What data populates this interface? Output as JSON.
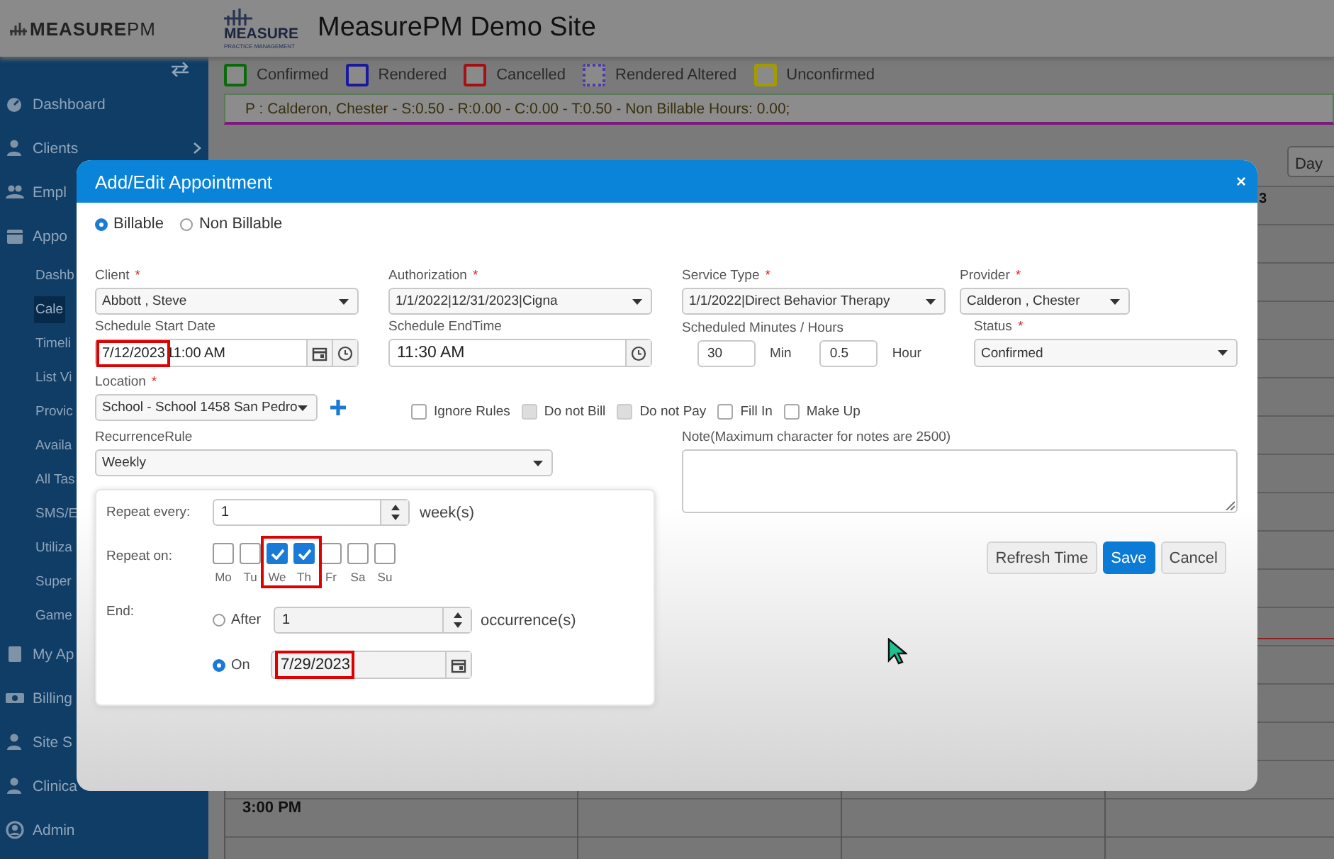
{
  "header": {
    "logo": "**MEASURE**PM",
    "brand_logo": "MEASURE",
    "brand_tagline": "PRACTICE MANAGEMENT",
    "title": "MeasurePM Demo Site"
  },
  "sidebar": {
    "items": [
      {
        "label": "Dashboard",
        "kind": "main",
        "selected": false,
        "expandable": false
      },
      {
        "label": "Clients",
        "kind": "main",
        "selected": false,
        "expandable": true
      },
      {
        "label": "Empl",
        "kind": "main",
        "selected": false,
        "expandable": false
      },
      {
        "label": "Appo",
        "kind": "main",
        "selected": false,
        "expandable": false
      },
      {
        "label": "Dashb",
        "kind": "sub",
        "selected": false,
        "expandable": false
      },
      {
        "label": "Cale",
        "kind": "sub",
        "selected": true,
        "expandable": false
      },
      {
        "label": "Timeli",
        "kind": "sub",
        "selected": false,
        "expandable": false
      },
      {
        "label": "List Vi",
        "kind": "sub",
        "selected": false,
        "expandable": false
      },
      {
        "label": "Provic",
        "kind": "sub",
        "selected": false,
        "expandable": false
      },
      {
        "label": "Availa",
        "kind": "sub",
        "selected": false,
        "expandable": false
      },
      {
        "label": "All Tas",
        "kind": "sub",
        "selected": false,
        "expandable": false
      },
      {
        "label": "SMS/E",
        "kind": "sub",
        "selected": false,
        "expandable": false
      },
      {
        "label": "Utiliza",
        "kind": "sub",
        "selected": false,
        "expandable": false
      },
      {
        "label": "Super",
        "kind": "sub",
        "selected": false,
        "expandable": false
      },
      {
        "label": "Game",
        "kind": "sub",
        "selected": false,
        "expandable": false
      },
      {
        "label": "My Ap",
        "kind": "main",
        "selected": false,
        "expandable": false
      },
      {
        "label": "Billing",
        "kind": "main",
        "selected": false,
        "expandable": false
      },
      {
        "label": "Site S",
        "kind": "main",
        "selected": false,
        "expandable": false
      },
      {
        "label": "Clinica",
        "kind": "main",
        "selected": false,
        "expandable": false
      },
      {
        "label": "Admin",
        "kind": "main",
        "selected": false,
        "expandable": false
      }
    ]
  },
  "legend": [
    {
      "label": "Confirmed",
      "color": "#0b6b0b",
      "kind": "solid"
    },
    {
      "label": "Rendered",
      "color": "#1a1a9c",
      "kind": "solid"
    },
    {
      "label": "Cancelled",
      "color": "#a31212",
      "kind": "solid"
    },
    {
      "label": "Rendered Altered",
      "color": "#4b3ca6",
      "kind": "dotted"
    },
    {
      "label": "Unconfirmed",
      "color": "#a39c00",
      "kind": "solid"
    }
  ],
  "status_line": "P : Calderon, Chester - S:0.50 - R:0.00 - C:0.00 - T:0.50 - Non Billable Hours: 0.00;",
  "calendar": {
    "view_button": "Day",
    "column_header": "3",
    "time_label": "3:00 PM"
  },
  "modal": {
    "title": "Add/Edit Appointment",
    "close": "×",
    "billing": [
      {
        "label": "Billable",
        "selected": true
      },
      {
        "label": "Non Billable",
        "selected": false
      }
    ],
    "client": {
      "label": "Client",
      "required_mark": "*",
      "value": "Abbott , Steve"
    },
    "authorization": {
      "label": "Authorization",
      "required_mark": "*",
      "value": "1/1/2022|12/31/2023|Cigna"
    },
    "service_type": {
      "label": "Service Type",
      "required_mark": "*",
      "value": "1/1/2022|Direct Behavior Therapy"
    },
    "provider": {
      "label": "Provider",
      "required_mark": "*",
      "value": "Calderon , Chester"
    },
    "start": {
      "label": "Schedule Start Date",
      "date": "7/12/2023",
      "time": "11:00 AM",
      "highlighted": true
    },
    "end_time": {
      "label": "Schedule EndTime",
      "value": "11:30 AM"
    },
    "scheduled": {
      "label": "Scheduled Minutes / Hours",
      "minutes": "30",
      "minutes_unit": "Min",
      "hours": "0.5",
      "hours_unit": "Hour"
    },
    "status": {
      "label": "Status",
      "required_mark": "*",
      "value": "Confirmed"
    },
    "location": {
      "label": "Location",
      "required_mark": "*",
      "value": "School - School 1458 San Pedro"
    },
    "options": [
      {
        "label": "Ignore Rules",
        "checked": false,
        "disabled": false
      },
      {
        "label": "Do not Bill",
        "checked": false,
        "disabled": true
      },
      {
        "label": "Do not Pay",
        "checked": false,
        "disabled": true
      },
      {
        "label": "Fill In",
        "checked": false,
        "disabled": false
      },
      {
        "label": "Make Up",
        "checked": false,
        "disabled": false
      }
    ],
    "recurrence_rule": {
      "label": "RecurrenceRule",
      "value": "Weekly"
    },
    "note": {
      "label": "Note(Maximum character for notes are 2500)"
    },
    "recurrence": {
      "repeat_every": {
        "label": "Repeat every:",
        "value": "1",
        "unit": "week(s)"
      },
      "repeat_on": {
        "label": "Repeat on:",
        "highlighted": true,
        "days": [
          {
            "label": "Mo",
            "checked": false
          },
          {
            "label": "Tu",
            "checked": false
          },
          {
            "label": "We",
            "checked": true
          },
          {
            "label": "Th",
            "checked": true
          },
          {
            "label": "Fr",
            "checked": false
          },
          {
            "label": "Sa",
            "checked": false
          },
          {
            "label": "Su",
            "checked": false
          }
        ]
      },
      "end": {
        "label": "End:",
        "options": [
          {
            "kind": "after",
            "label": "After",
            "selected": false,
            "value": "1",
            "unit": "occurrence(s)",
            "highlighted": false
          },
          {
            "kind": "on",
            "label": "On",
            "selected": true,
            "value": "7/29/2023",
            "highlighted": true
          }
        ]
      }
    },
    "buttons": [
      {
        "label": "Refresh Time",
        "kind": "default"
      },
      {
        "label": "Save",
        "kind": "primary"
      },
      {
        "label": "Cancel",
        "kind": "default"
      }
    ]
  }
}
